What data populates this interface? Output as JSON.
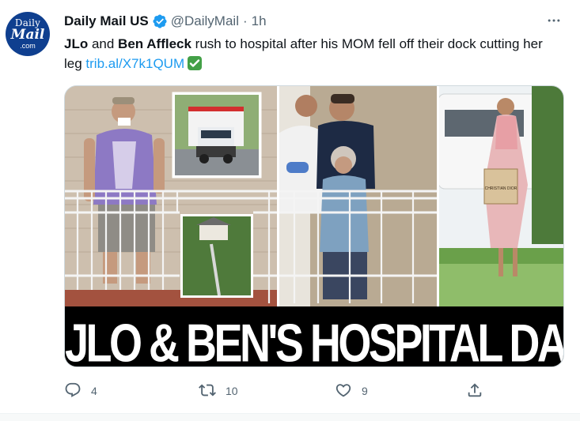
{
  "account": {
    "avatar_lines": [
      "Daily",
      "Mail",
      ".com"
    ],
    "name": "Daily Mail US",
    "handle": "@DailyMail",
    "separator": "·",
    "time": "1h"
  },
  "tweet": {
    "part1_bold": "JLo",
    "part2": " and ",
    "part3_bold": "Ben Affleck",
    "part4": " rush to hospital after his MOM fell off their dock cutting her leg ",
    "link": "trib.al/X7k1QUM"
  },
  "media": {
    "headline": "JLO & BEN'S HOSPITAL DASH",
    "bag_text": "CHRISTIAN DIOR"
  },
  "actions": {
    "reply_count": "4",
    "retweet_count": "10",
    "like_count": "9"
  },
  "colors": {
    "accent": "#1d9bf0",
    "muted": "#536471",
    "verified": "#1d9bf0"
  }
}
